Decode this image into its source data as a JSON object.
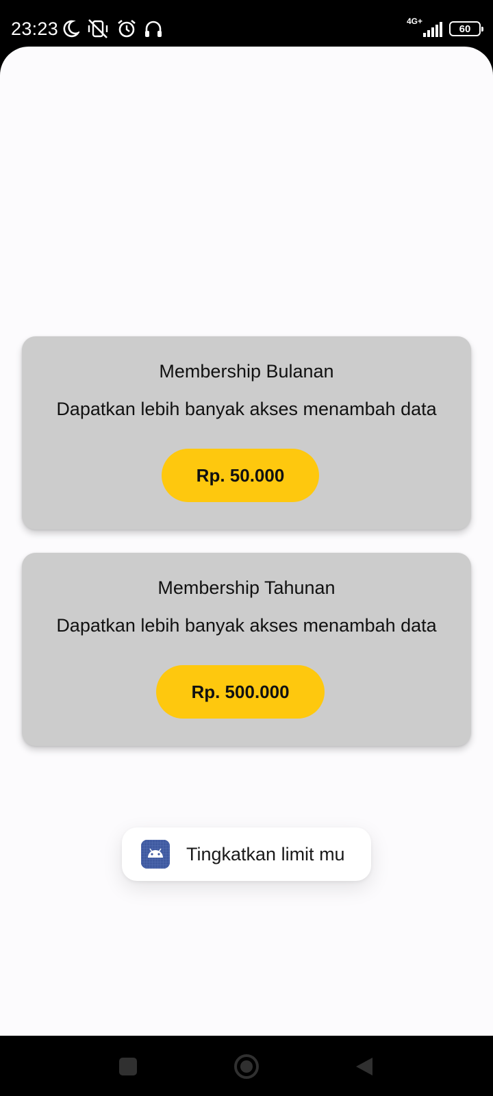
{
  "status_bar": {
    "time": "23:23",
    "network": "4G+",
    "battery": "60",
    "icons": [
      "moon-icon",
      "vibrate-off-icon",
      "alarm-icon",
      "headphones-icon",
      "signal-icon",
      "battery-icon"
    ]
  },
  "cards": [
    {
      "title": "Membership Bulanan",
      "description": "Dapatkan lebih banyak akses menambah data",
      "price": "Rp. 50.000"
    },
    {
      "title": "Membership Tahunan",
      "description": "Dapatkan lebih banyak akses menambah data",
      "price": "Rp. 500.000"
    }
  ],
  "toast": {
    "message": "Tingkatkan limit mu",
    "icon": "android-app-icon"
  },
  "navigation": {
    "icons": [
      "recent-apps-icon",
      "home-icon",
      "back-icon"
    ]
  },
  "colors": {
    "card_background": "#cccccc",
    "price_button": "#fec80e",
    "screen_background": "#fcfbfd",
    "app_icon": "#3f5aa0"
  }
}
